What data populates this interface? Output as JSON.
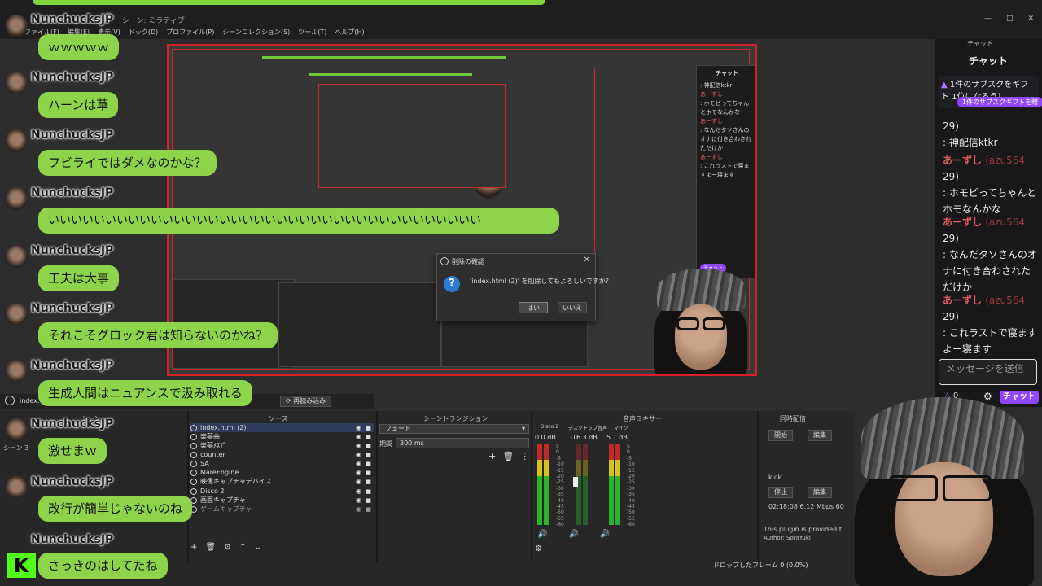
{
  "app": {
    "channel_name": "NunchucksJP",
    "window_title": "シーン: ミラティブ",
    "menu": [
      "ファイル(F)",
      "編集(E)",
      "表示(V)",
      "ドック(D)",
      "プロファイル(P)",
      "シーンコレクション(S)",
      "ツール(T)",
      "ヘルプ(H)"
    ]
  },
  "overlay_chat": {
    "messages": [
      {
        "user": "NunchucksJP",
        "text": "ｗｗｗｗｗ"
      },
      {
        "user": "NunchucksJP",
        "text": "ハーンは草"
      },
      {
        "user": "NunchucksJP",
        "text": "フビライではダメなのかな？"
      },
      {
        "user": "NunchucksJP",
        "text": "いいいいいいいいいいいいいいいいいいいいいいいいいいいいいいいいいいいいいい"
      },
      {
        "user": "NunchucksJP",
        "text": "工夫は大事"
      },
      {
        "user": "NunchucksJP",
        "text": "それこそグロック君は知らないのかね？"
      },
      {
        "user": "NunchucksJP",
        "text": "生成人間はニュアンスで汲み取れる"
      },
      {
        "user": "NunchucksJP",
        "text": "激せまｗ"
      },
      {
        "user": "NunchucksJP",
        "text": "改行が簡単じゃないのね"
      },
      {
        "user": "NunchucksJP",
        "text": "さっきのはしてたね"
      }
    ]
  },
  "dialog": {
    "title": "削除の確認",
    "message": "'index.html (2)' を削除してもよろしいですか？",
    "yes_label": "はい",
    "no_label": "いいえ"
  },
  "docks": {
    "scenes": {
      "title": "シーン",
      "items": [
        "シーン 3"
      ]
    },
    "sources": {
      "title": "ソース",
      "items": [
        "index.html (2)",
        "楽夢曲",
        "楽夢ﾒｽﾌﾟ",
        "counter",
        "SA",
        "MareEngine",
        "映像キャプチャデバイス",
        "Disco 2",
        "画面キャプチャ",
        "ゲームキャプチャ"
      ],
      "selected": "index.html (2)"
    },
    "transitions": {
      "title": "シーントランジション",
      "type": "フェード",
      "duration_label": "期間",
      "duration": "300 ms"
    },
    "mixer": {
      "title": "音声ミキサー",
      "channels": [
        {
          "name": "Disco 2",
          "db": "0.0 dB"
        },
        {
          "name": "デスクトップ音声",
          "db": "-16.3 dB"
        },
        {
          "name": "マイク",
          "db": "5.1 dB"
        }
      ],
      "scale": [
        "5",
        "0",
        "-5",
        "-10",
        "-15",
        "-20",
        "-25",
        "-30",
        "-35",
        "-40",
        "-45",
        "-50",
        "-55",
        "-60"
      ]
    },
    "multistream": {
      "title": "同時配信",
      "start_label": "開始",
      "edit_label": "編集",
      "stop_label": "停止",
      "target": "kick",
      "stats": "02:18:08  6.12 Mbps  60",
      "plugin_note": "This plugin is provided f",
      "author": "Author: SoraYuki"
    },
    "current_source_label": "index.",
    "reload_label": "再読み込み",
    "dropped_frames": "ドロップしたフレーム 0 (0.0%)"
  },
  "twitch_chat": {
    "header": "チャット",
    "tab": "チャット",
    "gift_text": "1件のサブスクをギフト 1位になろう！",
    "gift_button": "1件のサブスクギフトを贈",
    "messages": [
      {
        "name": "",
        "text": "29)"
      },
      {
        "name": "",
        "text": ": 神配信ktkr"
      },
      {
        "name": "あーずし",
        "uid": "(azu564",
        "text": "29)"
      },
      {
        "name": "",
        "text": ": ホモピってちゃんとホモなんかな"
      },
      {
        "name": "あーずし",
        "uid": "(azu564",
        "text": "29)"
      },
      {
        "name": "",
        "text": ": なんだタソさんのオナに付き合わされただけか"
      },
      {
        "name": "あーずし",
        "uid": "(azu564",
        "text": "29)"
      },
      {
        "name": "",
        "text": ": これラストで寝ますよー寝ます"
      }
    ],
    "send_placeholder": "メッセージを送信",
    "points": "0",
    "chat_button": "チャット"
  },
  "colors": {
    "bubble": "#8ed44a",
    "kick_green": "#53fc18",
    "twitch_purple": "#9147ff",
    "preview_border": "#d8202a"
  }
}
